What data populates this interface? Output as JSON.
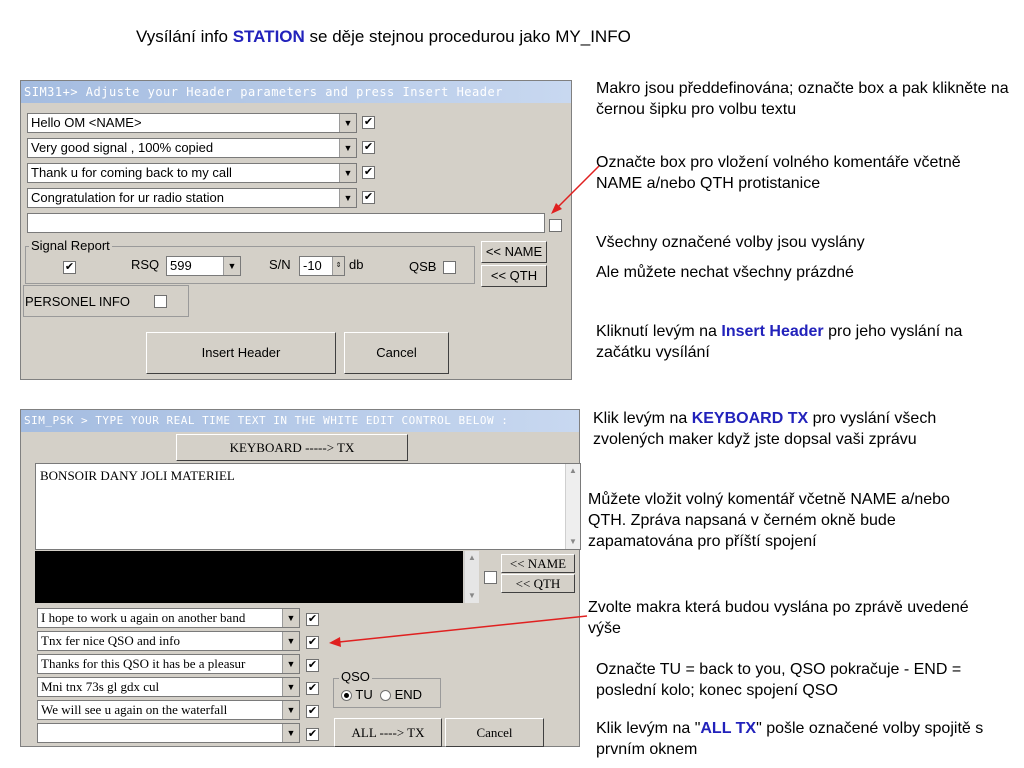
{
  "slide": {
    "title_pre": "Vysílání info ",
    "title_hl": "STATION",
    "title_post": "  se děje stejnou procedurou jako MY_INFO"
  },
  "header_window": {
    "title": "SIM31+> Adjuste your Header parameters and  press Insert  Header",
    "macros": [
      {
        "text": "Hello OM <NAME>",
        "checked": "✔"
      },
      {
        "text": "Very  good signal , 100% copied",
        "checked": "✔"
      },
      {
        "text": "Thank u for coming back to my call",
        "checked": "✔"
      },
      {
        "text": "Congratulation for ur radio station",
        "checked": "✔"
      }
    ],
    "free_text": "",
    "signal_report": {
      "label": "Signal Report",
      "rsq_label": "RSQ",
      "rsq_value": "599",
      "sn_label": "S/N",
      "sn_value": "-10",
      "db_label": "db",
      "qsb_label": "QSB"
    },
    "name_button": "<< NAME",
    "qth_button": "<< QTH",
    "personel_info": "PERSONEL INFO",
    "insert_header": "Insert Header",
    "cancel": "Cancel"
  },
  "psk_window": {
    "title": "SIM_PSK >  TYPE YOUR REAL TIME TEXT IN THE WHITE EDIT CONTROL BELOW :",
    "keyboard_button": "KEYBOARD -----> TX",
    "edit_text": "BONSOIR DANY JOLI MATERIEL",
    "name_button": "<< NAME",
    "qth_button": "<< QTH",
    "macros": [
      {
        "text": "I hope to work u again on another band",
        "checked": "✔"
      },
      {
        "text": "Tnx fer nice QSO and info",
        "checked": "✔"
      },
      {
        "text": "Thanks for this QSO it has be a pleasur",
        "checked": "✔"
      },
      {
        "text": "Mni tnx 73s gl gdx cul",
        "checked": "✔"
      },
      {
        "text": "We will see u again on the waterfall",
        "checked": "✔"
      },
      {
        "text": "",
        "checked": "✔"
      }
    ],
    "qso_label": "QSO",
    "tu_label": "TU",
    "end_label": "END",
    "all_tx_button": "ALL ----> TX",
    "cancel": "Cancel"
  },
  "notes": {
    "n1": "Makro jsou předdefinována; označte box a pak klikněte na černou šipku pro volbu textu",
    "n2": "Označte box pro vložení volného komentáře včetně  NAME a/nebo QTH protistanice",
    "n3": "Všechny označené volby jsou vyslány",
    "n4": "Ale můžete nechat všechny prázdné",
    "n5_pre": "Kliknutí levým na ",
    "n5_hl": "Insert Header",
    "n5_post": " pro jeho vyslání na začátku vysílání",
    "n6_pre": "Klik levým na ",
    "n6_hl": "KEYBOARD TX",
    "n6_post": " pro vyslání všech zvolených maker když jste dopsal vaši zprávu",
    "n7": "Můžete vložit volný komentář včetně NAME a/nebo QTH. Zpráva napsaná v černém okně bude zapamatována pro příští spojení",
    "n8": "Zvolte makra která budou vyslána po zprávě uvedené výše",
    "n9": "Označte TU = back to you,  QSO pokračuje  - END = poslední kolo; konec spojení QSO",
    "n10_pre": "Klik levým na \"",
    "n10_hl": "ALL TX",
    "n10_post": "\" pošle označené volby spojitě s prvním oknem"
  },
  "colors": {
    "accent": "#2222bb",
    "arrow": "#e02020"
  }
}
